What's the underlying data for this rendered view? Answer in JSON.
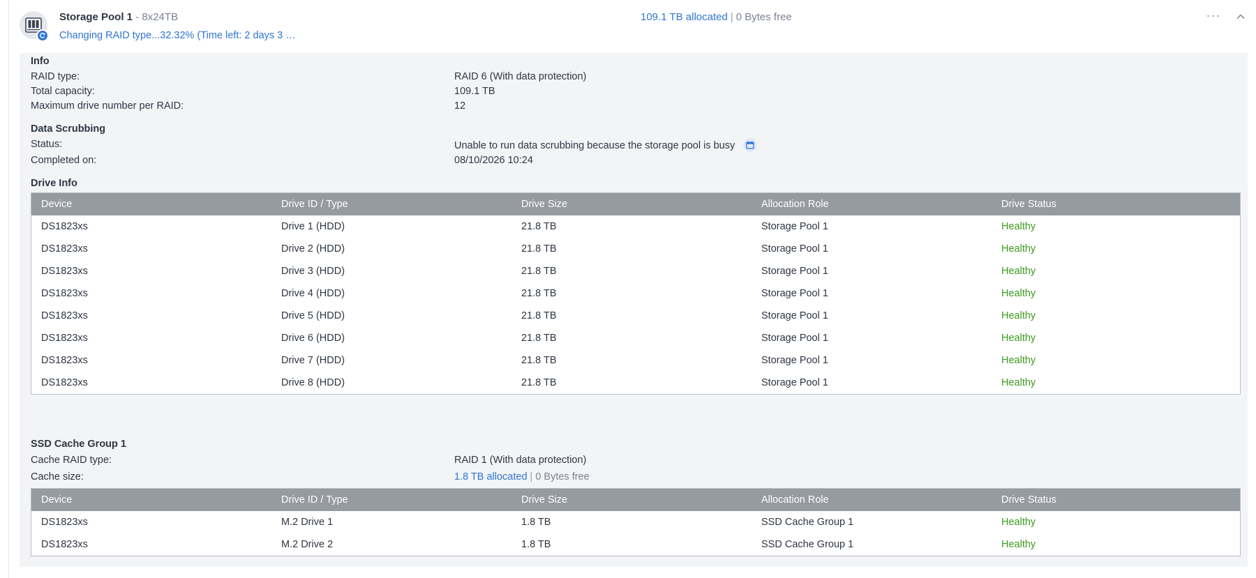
{
  "pool": {
    "name": "Storage Pool 1",
    "sep": " - ",
    "config": "8x24TB",
    "status": "Changing RAID type...32.32% (Time left: 2 days 3 …",
    "allocated": "109.1 TB allocated",
    "divider": "|",
    "free": "0 Bytes free",
    "more_label": "···"
  },
  "info": {
    "title": "Info",
    "rows": [
      {
        "label": "RAID type:",
        "value": "RAID 6 (With data protection)"
      },
      {
        "label": "Total capacity:",
        "value": "109.1 TB"
      },
      {
        "label": "Maximum drive number per RAID:",
        "value": "12"
      }
    ]
  },
  "scrubbing": {
    "title": "Data Scrubbing",
    "status_label": "Status:",
    "status_value": "Unable to run data scrubbing because the storage pool is busy",
    "completed_label": "Completed on:",
    "completed_value": "08/10/2026 10:24"
  },
  "drive_info": {
    "title": "Drive Info",
    "columns": [
      "Device",
      "Drive ID / Type",
      "Drive Size",
      "Allocation Role",
      "Drive Status"
    ],
    "rows": [
      [
        "DS1823xs",
        "Drive 1 (HDD)",
        "21.8 TB",
        "Storage Pool 1",
        "Healthy"
      ],
      [
        "DS1823xs",
        "Drive 2 (HDD)",
        "21.8 TB",
        "Storage Pool 1",
        "Healthy"
      ],
      [
        "DS1823xs",
        "Drive 3 (HDD)",
        "21.8 TB",
        "Storage Pool 1",
        "Healthy"
      ],
      [
        "DS1823xs",
        "Drive 4 (HDD)",
        "21.8 TB",
        "Storage Pool 1",
        "Healthy"
      ],
      [
        "DS1823xs",
        "Drive 5 (HDD)",
        "21.8 TB",
        "Storage Pool 1",
        "Healthy"
      ],
      [
        "DS1823xs",
        "Drive 6 (HDD)",
        "21.8 TB",
        "Storage Pool 1",
        "Healthy"
      ],
      [
        "DS1823xs",
        "Drive 7 (HDD)",
        "21.8 TB",
        "Storage Pool 1",
        "Healthy"
      ],
      [
        "DS1823xs",
        "Drive 8 (HDD)",
        "21.8 TB",
        "Storage Pool 1",
        "Healthy"
      ]
    ]
  },
  "ssd_cache": {
    "title": "SSD Cache Group 1",
    "raid_label": "Cache RAID type:",
    "raid_value": "RAID 1 (With data protection)",
    "size_label": "Cache size:",
    "size_allocated": "1.8 TB allocated",
    "size_divider": "|",
    "size_free": "0 Bytes free",
    "columns": [
      "Device",
      "Drive ID / Type",
      "Drive Size",
      "Allocation Role",
      "Drive Status"
    ],
    "rows": [
      [
        "DS1823xs",
        "M.2 Drive 1",
        "1.8 TB",
        "SSD Cache Group 1",
        "Healthy"
      ],
      [
        "DS1823xs",
        "M.2 Drive 2",
        "1.8 TB",
        "SSD Cache Group 1",
        "Healthy"
      ]
    ]
  },
  "colors": {
    "accent": "#2f76d2",
    "healthy": "#3c9a1e",
    "table_header": "#969aa1",
    "panel_bg": "#f3f4f6"
  },
  "icons": [
    "storage-pool-icon",
    "raid-change-badge-icon",
    "more-icon",
    "chevron-up-icon",
    "scrub-schedule-icon"
  ]
}
